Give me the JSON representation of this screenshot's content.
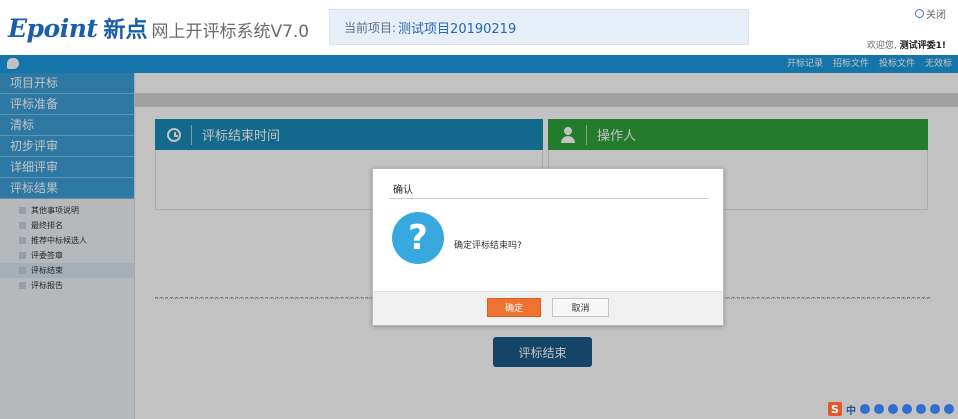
{
  "header": {
    "logo_brand": "Epoint",
    "logo_name": "新点",
    "logo_system": "网上开评标系统V7.0",
    "project_label": "当前项目:",
    "project_name": "测试项目20190219",
    "close_label": "关闭",
    "welcome_prefix": "欢迎您,",
    "welcome_user": "测试评委1!"
  },
  "topbar": {
    "links": [
      "开标记录",
      "招标文件",
      "投标文件",
      "无效标"
    ]
  },
  "sidebar": {
    "items": [
      {
        "label": "项目开标"
      },
      {
        "label": "评标准备"
      },
      {
        "label": "清标"
      },
      {
        "label": "初步评审"
      },
      {
        "label": "详细评审"
      },
      {
        "label": "评标结果"
      }
    ],
    "subitems": [
      {
        "label": "其他事项说明"
      },
      {
        "label": "最终排名"
      },
      {
        "label": "推荐中标候选人"
      },
      {
        "label": "评委签章"
      },
      {
        "label": "评标结束"
      },
      {
        "label": "评标报告"
      }
    ]
  },
  "main": {
    "panel_left_title": "评标结束时间",
    "panel_right_title": "操作人",
    "end_button": "评标结束"
  },
  "dialog": {
    "title": "确认",
    "icon_glyph": "?",
    "message": "确定评标结束吗?",
    "ok_label": "确定",
    "cancel_label": "取消"
  },
  "ime": {
    "logo": "S",
    "mode": "中"
  },
  "colors": {
    "brand_blue": "#1a5fa8",
    "topbar_blue": "#1b9ae0",
    "sidebar_item": "#3c9fd8",
    "panel_teal": "#1a8bb9",
    "panel_green": "#2da43b",
    "end_button": "#1c5a8b",
    "confirm_orange": "#ee7333",
    "question_blue": "#38a9df"
  }
}
